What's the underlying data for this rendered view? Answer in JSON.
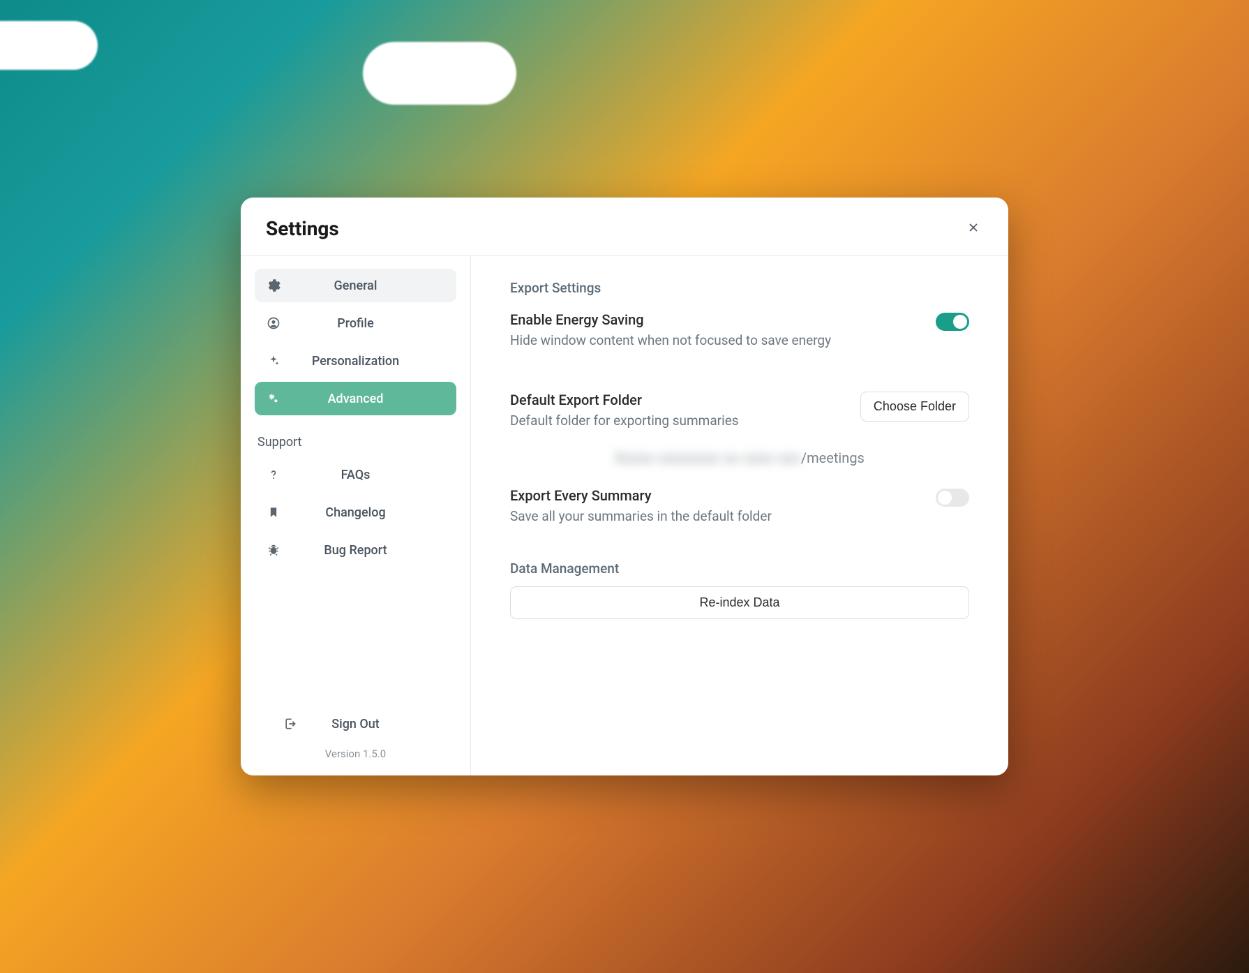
{
  "modal": {
    "title": "Settings"
  },
  "sidebar": {
    "items": [
      {
        "id": "general",
        "label": "General"
      },
      {
        "id": "profile",
        "label": "Profile"
      },
      {
        "id": "personalization",
        "label": "Personalization"
      },
      {
        "id": "advanced",
        "label": "Advanced"
      }
    ],
    "support_label": "Support",
    "support_items": [
      {
        "id": "faqs",
        "label": "FAQs"
      },
      {
        "id": "changelog",
        "label": "Changelog"
      },
      {
        "id": "bugreport",
        "label": "Bug Report"
      }
    ],
    "signout_label": "Sign Out",
    "version_label": "Version 1.5.0"
  },
  "content": {
    "export_section_title": "Export Settings",
    "energy_saving": {
      "title": "Enable Energy Saving",
      "desc": "Hide window content when not focused to save energy",
      "enabled": true
    },
    "export_folder": {
      "title": "Default Export Folder",
      "desc": "Default folder for exporting summaries",
      "button_label": "Choose Folder",
      "path_visible_suffix": "/meetings"
    },
    "export_every": {
      "title": "Export Every Summary",
      "desc": "Save all your summaries in the default folder",
      "enabled": false
    },
    "data_mgmt": {
      "title": "Data Management",
      "reindex_label": "Re-index Data"
    }
  }
}
